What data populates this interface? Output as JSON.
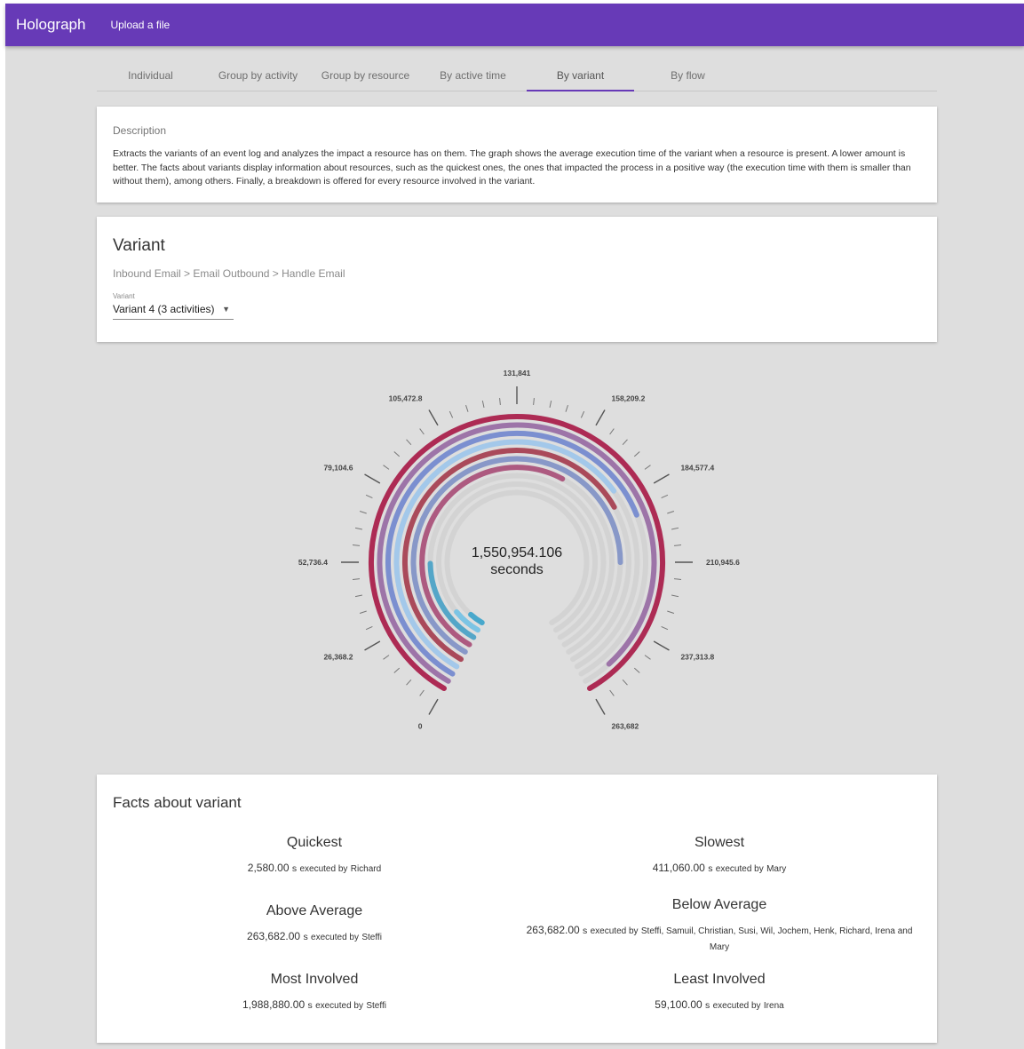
{
  "app": {
    "title": "Holograph",
    "upload_label": "Upload a file"
  },
  "tabs": [
    {
      "label": "Individual"
    },
    {
      "label": "Group by activity"
    },
    {
      "label": "Group by resource"
    },
    {
      "label": "By active time"
    },
    {
      "label": "By variant",
      "active": true
    },
    {
      "label": "By flow"
    }
  ],
  "description": {
    "title": "Description",
    "text": "Extracts the variants of an event log and analyzes the impact a resource has on them. The graph shows the average execution time of the variant when a resource is present. A lower amount is better. The facts about variants display information about resources, such as the quickest ones, the ones that impacted the process in a positive way (the execution time with them is smaller than without them), among others. Finally, a breakdown is offered for every resource involved in the variant."
  },
  "variant": {
    "title": "Variant",
    "path": "Inbound Email > Email Outbound > Handle Email",
    "select_label": "Variant",
    "selected": "Variant 4 (3 activities)"
  },
  "gauge": {
    "center_value": "1,550,954.106",
    "center_unit": "seconds",
    "max": 263682,
    "major_ticks": [
      "0",
      "26,368.2",
      "52,736.4",
      "79,104.6",
      "105,472.8",
      "131,841",
      "158,209.2",
      "184,577.4",
      "210,945.6",
      "237,313.8",
      "263,682"
    ],
    "arcs": [
      {
        "value": 263682,
        "color": "#ad2b54"
      },
      {
        "value": 253000,
        "color": "#9d74a8"
      },
      {
        "value": 192000,
        "color": "#7b8fd0"
      },
      {
        "value": 179000,
        "color": "#a3c8ea"
      },
      {
        "value": 185000,
        "color": "#aa4a5a"
      },
      {
        "value": 211000,
        "color": "#8898c8"
      },
      {
        "value": 157000,
        "color": "#ad5a80"
      },
      {
        "value": 52000,
        "color": "#54a6c8"
      },
      {
        "value": 18000,
        "color": "#7cc4e4"
      },
      {
        "value": 10000,
        "color": "#48a8cc"
      }
    ]
  },
  "facts": {
    "title": "Facts about variant",
    "unit": "s",
    "by": "executed by",
    "quickest": {
      "title": "Quickest",
      "value": "2,580.00",
      "who": "Richard"
    },
    "slowest": {
      "title": "Slowest",
      "value": "411,060.00",
      "who": "Mary"
    },
    "above_average": {
      "title": "Above Average",
      "value": "263,682.00",
      "who": "Steffi"
    },
    "below_average": {
      "title": "Below Average",
      "value": "263,682.00",
      "who": "Steffi, Samuil, Christian, Susi, Wil, Jochem, Henk, Richard, Irena and Mary"
    },
    "most_involved": {
      "title": "Most Involved",
      "value": "1,988,880.00",
      "who": "Steffi"
    },
    "least_involved": {
      "title": "Least Involved",
      "value": "59,100.00",
      "who": "Irena"
    }
  }
}
